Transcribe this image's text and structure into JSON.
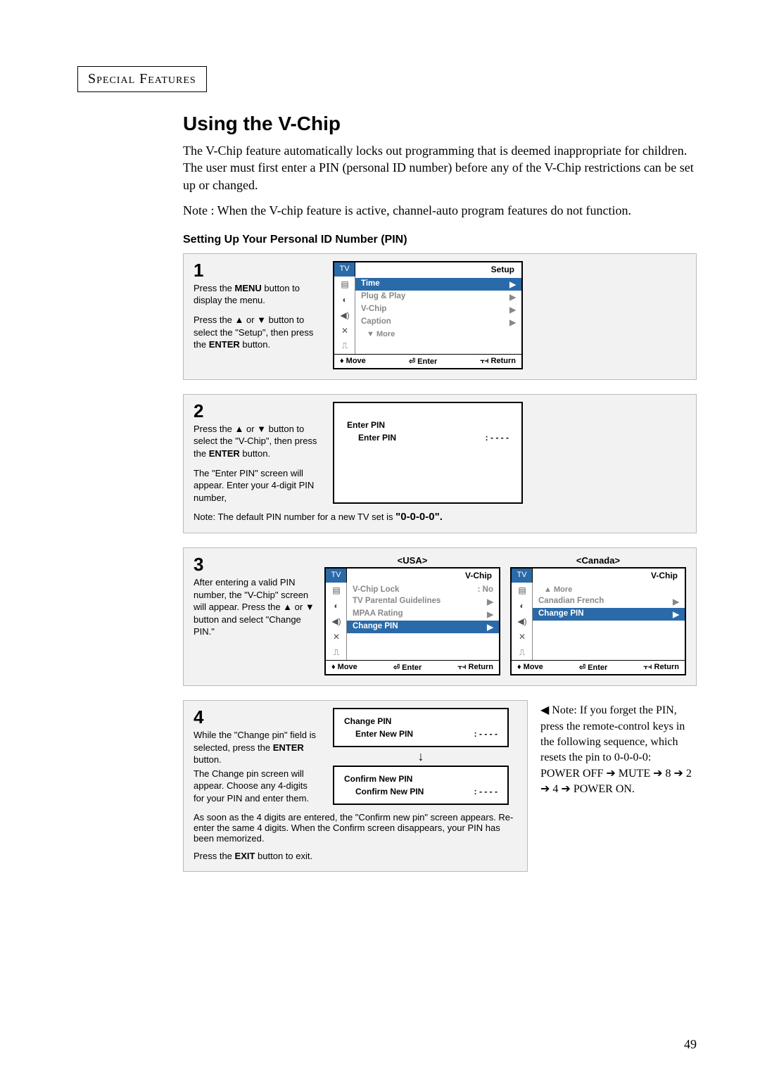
{
  "header": "Special Features",
  "page_number": "49",
  "title": "Using the V-Chip",
  "intro": "The V-Chip feature automatically locks out programming that is deemed inappropriate for children. The user must first enter a PIN (personal ID number) before any of the V-Chip restrictions can be set up or changed.",
  "note": "Note : When the V-chip feature is active, channel-auto program features do not function.",
  "subsection": "Setting Up Your Personal ID Number (PIN)",
  "step1": {
    "num": "1",
    "text1_a": "Press the ",
    "text1_b": "MENU",
    "text1_c": " button to display the menu.",
    "text2_a": "Press the ▲ or ▼ button to select the \"Setup\", then press the ",
    "text2_b": "ENTER",
    "text2_c": " button.",
    "osd": {
      "tab": "TV",
      "title": "Setup",
      "items": [
        {
          "label": "Time",
          "val": "▶",
          "hl": true
        },
        {
          "label": "Plug & Play",
          "val": "▶"
        },
        {
          "label": "V-Chip",
          "val": "▶"
        },
        {
          "label": "Caption",
          "val": "▶"
        },
        {
          "label": "▼ More",
          "val": "",
          "more": true
        }
      ],
      "footer": {
        "move": "♦ Move",
        "enter": "⏎ Enter",
        "ret": "⫟⫞ Return"
      }
    }
  },
  "step2": {
    "num": "2",
    "text_a": "Press the ▲ or ▼ button to select the \"V-Chip\", then press the ",
    "text_b": "ENTER",
    "text_c": " button.",
    "text2": "The \"Enter PIN\" screen will appear. Enter your 4-digit PIN number,",
    "footnote_a": "Note: The default PIN number for a new TV set is ",
    "footnote_b": "\"0-0-0-0\".",
    "osd": {
      "title": "Enter PIN",
      "row_label": "Enter PIN",
      "row_val": ": - - - -"
    }
  },
  "step3": {
    "num": "3",
    "text": "After entering a valid PIN number, the \"V-Chip\" screen will appear. Press the ▲ or ▼ button and select \"Change PIN.\"",
    "usa_title": "<USA>",
    "canada_title": "<Canada>",
    "osd_usa": {
      "tab": "TV",
      "title": "V-Chip",
      "items": [
        {
          "label": "V-Chip Lock",
          "val": ": No"
        },
        {
          "label": "TV Parental Guidelines",
          "val": "▶"
        },
        {
          "label": "MPAA Rating",
          "val": "▶"
        },
        {
          "label": "Change PIN",
          "val": "▶",
          "hl": true
        }
      ],
      "footer": {
        "move": "♦ Move",
        "enter": "⏎ Enter",
        "ret": "⫟⫞ Return"
      }
    },
    "osd_can": {
      "tab": "TV",
      "title": "V-Chip",
      "items": [
        {
          "label": "▲ More",
          "val": "",
          "more": true
        },
        {
          "label": "Canadian French",
          "val": "▶"
        },
        {
          "label": "Change PIN",
          "val": "▶",
          "hl": true
        }
      ],
      "footer": {
        "move": "♦ Move",
        "enter": "⏎ Enter",
        "ret": "⫟⫞ Return"
      }
    }
  },
  "step4": {
    "num": "4",
    "text_a": "While the \"Change pin\" field is selected, press the ",
    "text_b": "ENTER",
    "text_c": " button.",
    "text2": "The Change pin screen will appear. Choose any 4-digits for your PIN and enter them.",
    "footnote": "As soon as the 4 digits are entered, the \"Confirm new pin\" screen appears. Re-enter the same 4 digits. When the Confirm screen disappears, your PIN has been memorized.",
    "footnote2_a": "Press the ",
    "footnote2_b": "EXIT",
    "footnote2_c": " button to exit.",
    "osd1": {
      "title": "Change PIN",
      "row_label": "Enter New PIN",
      "row_val": ": - - - -"
    },
    "osd2": {
      "title": "Confirm New PIN",
      "row_label": "Confirm New PIN",
      "row_val": ": - - - -"
    },
    "sidenote_a": "◀ Note: If you forget the PIN, press the remote-control keys in the following sequence, which resets the pin to 0-0-0-0:",
    "sidenote_b": "POWER OFF ➔ MUTE ➔ 8 ➔ 2 ➔ 4 ➔ POWER ON."
  }
}
